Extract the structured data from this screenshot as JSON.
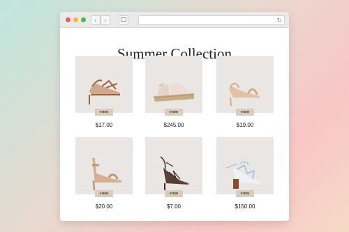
{
  "browser": {
    "back_icon": "‹",
    "forward_icon": "›",
    "reload_icon": "↻"
  },
  "page": {
    "title": "Summer Collection"
  },
  "products": [
    {
      "image": "sandal-strappy-tan",
      "button": "VIEW",
      "price": "$17.00"
    },
    {
      "image": "sandal-platform-espadrille",
      "button": "VIEW",
      "price": "$245.00"
    },
    {
      "image": "sandal-slingback-beige",
      "button": "VIEW",
      "price": "$19.00"
    },
    {
      "image": "sandal-ankle-strap-nude",
      "button": "VIEW",
      "price": "$20.00"
    },
    {
      "image": "sandal-lace-up-dark",
      "button": "VIEW",
      "price": "$7.00"
    },
    {
      "image": "sandal-lace-up-blue-block",
      "button": "VIEW",
      "price": "$150.00"
    }
  ],
  "colors": {
    "button_bg": "#d9ccbd",
    "thumb_bg": "#e9e6e4"
  }
}
